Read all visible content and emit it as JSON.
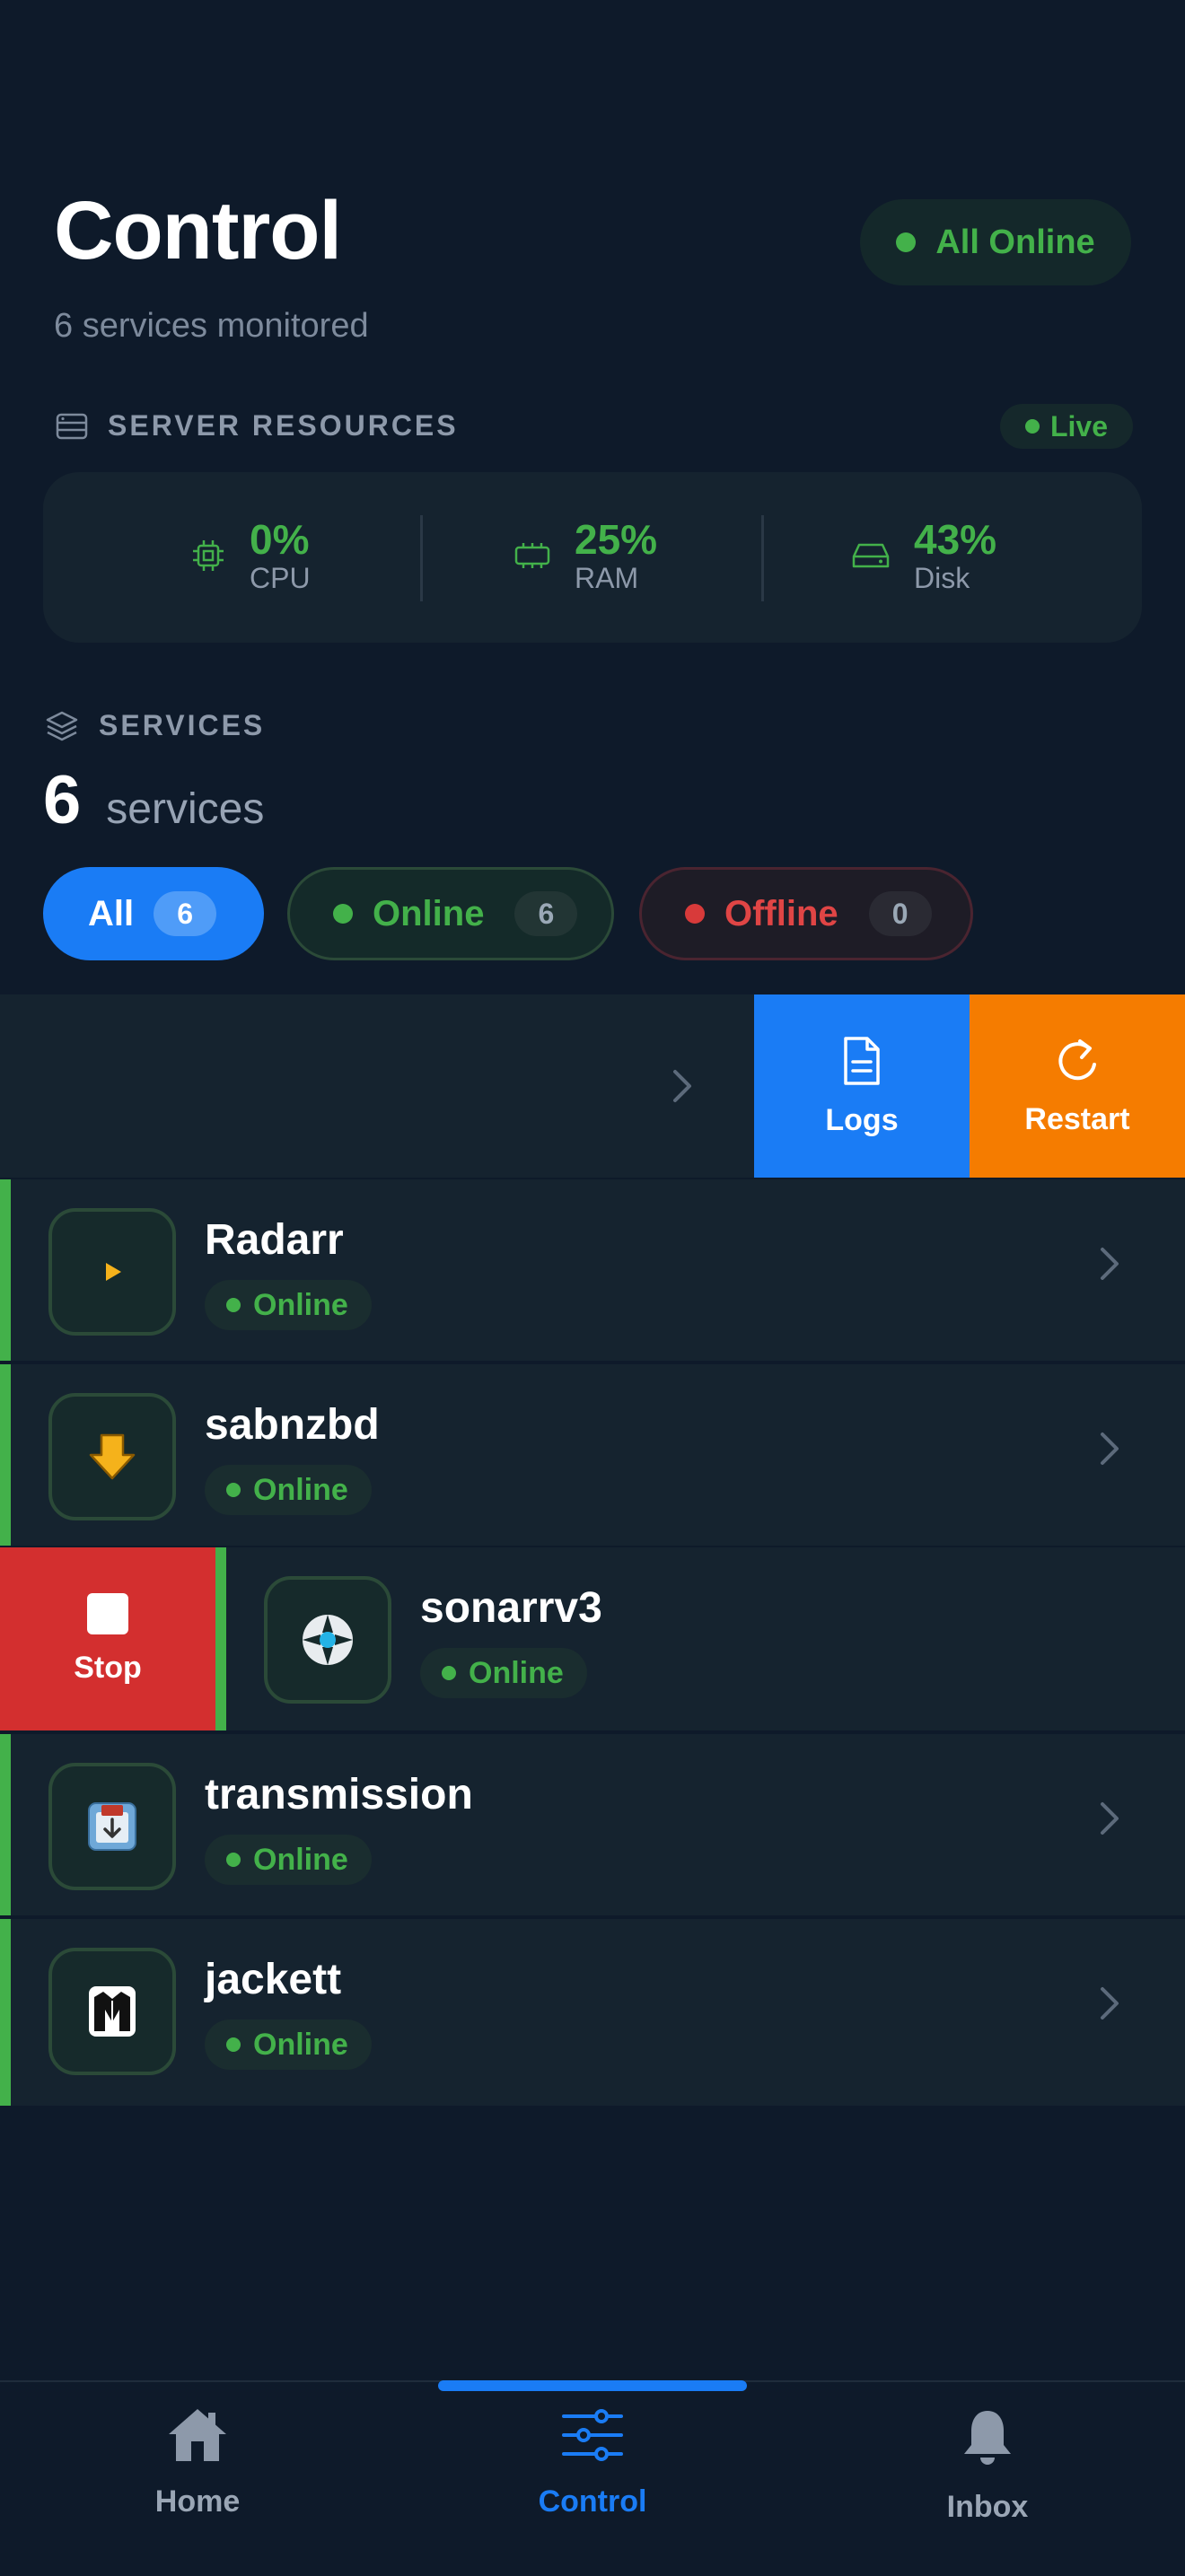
{
  "header": {
    "title": "Control",
    "subtitle": "6 services monitored",
    "status": "All Online"
  },
  "resources": {
    "heading": "SERVER RESOURCES",
    "live": "Live",
    "items": [
      {
        "label": "CPU",
        "value": "0%",
        "icon": "cpu-icon"
      },
      {
        "label": "RAM",
        "value": "25%",
        "icon": "memory-icon"
      },
      {
        "label": "Disk",
        "value": "43%",
        "icon": "disk-icon"
      }
    ]
  },
  "services": {
    "heading": "SERVICES",
    "count": "6",
    "count_label": "services",
    "filters": [
      {
        "label": "All",
        "count": "6"
      },
      {
        "label": "Online",
        "count": "6"
      },
      {
        "label": "Offline",
        "count": "0"
      }
    ],
    "items": [
      {
        "name": "Radarr",
        "status": "Online"
      },
      {
        "name": "sabnzbd",
        "status": "Online"
      },
      {
        "name": "sonarrv3",
        "status": "Online"
      },
      {
        "name": "transmission",
        "status": "Online"
      },
      {
        "name": "jackett",
        "status": "Online"
      }
    ],
    "actions": {
      "logs": "Logs",
      "restart": "Restart",
      "stop": "Stop"
    }
  },
  "nav": {
    "items": [
      {
        "label": "Home",
        "icon": "home-icon"
      },
      {
        "label": "Control",
        "icon": "sliders-icon"
      },
      {
        "label": "Inbox",
        "icon": "bell-icon"
      }
    ],
    "active": "Control"
  },
  "colors": {
    "accent": "#1a7cf5",
    "online": "#43b14a",
    "offline": "#d83a3a",
    "restart": "#f57c00",
    "stop": "#d32f2f",
    "background": "#0e1a2a"
  }
}
